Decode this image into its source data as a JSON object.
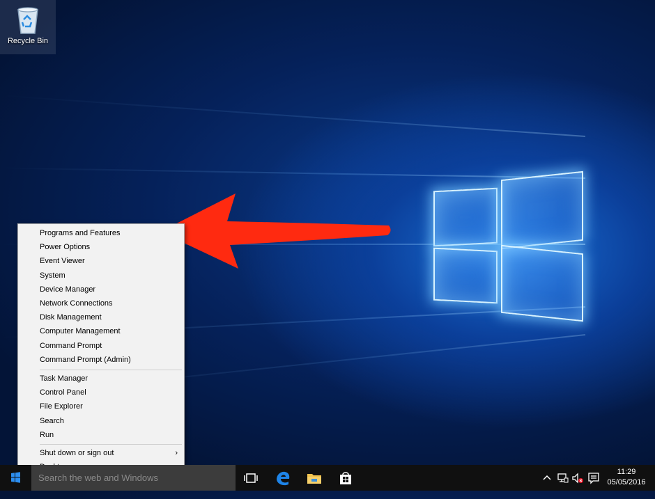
{
  "desktop": {
    "recycle_bin_label": "Recycle Bin"
  },
  "menu": {
    "group1": [
      "Programs and Features",
      "Power Options",
      "Event Viewer",
      "System",
      "Device Manager",
      "Network Connections",
      "Disk Management",
      "Computer Management",
      "Command Prompt",
      "Command Prompt (Admin)"
    ],
    "group2": [
      "Task Manager",
      "Control Panel",
      "File Explorer",
      "Search",
      "Run"
    ],
    "group3": [
      "Shut down or sign out",
      "Desktop"
    ]
  },
  "taskbar": {
    "search_placeholder": "Search the web and Windows",
    "clock_time": "11:29",
    "clock_date": "05/05/2016"
  },
  "colors": {
    "arrow": "#ff2a10",
    "taskbar": "#101010",
    "menu_bg": "#f2f2f2",
    "wallpaper": "#0b3f9a"
  },
  "icons": [
    "recycle-bin-icon",
    "windows-start-icon",
    "task-view-icon",
    "edge-icon",
    "file-explorer-icon",
    "store-icon",
    "chevron-up-icon",
    "network-icon",
    "volume-muted-icon",
    "action-center-icon",
    "chevron-right-icon"
  ]
}
